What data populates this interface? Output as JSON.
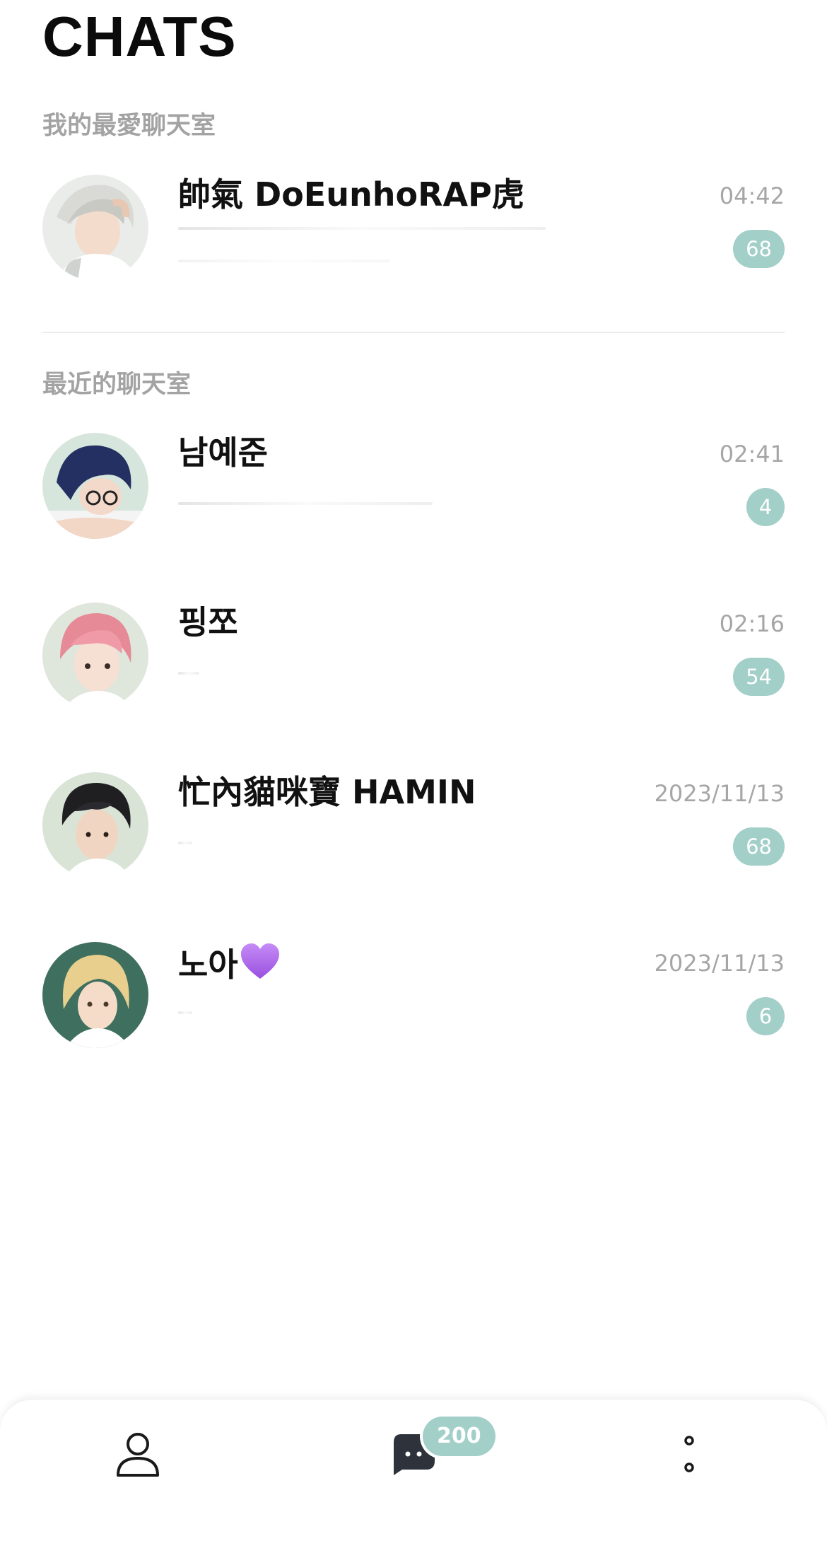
{
  "header": {
    "title": "CHATS"
  },
  "sections": {
    "favorites_label": "我的最愛聊天室",
    "recent_label": "最近的聊天室"
  },
  "favorites": [
    {
      "name": "帥氣 DoEunhoRAP虎",
      "time": "04:42",
      "unread": "68",
      "avatar": "avatar-silver-hair"
    }
  ],
  "recent": [
    {
      "name": "남예준",
      "time": "02:41",
      "unread": "4",
      "avatar": "avatar-navy-hair-glasses"
    },
    {
      "name": "핑쪼",
      "time": "02:16",
      "unread": "54",
      "avatar": "avatar-pink-hair"
    },
    {
      "name": "忙內貓咪寶 HAMIN",
      "time": "2023/11/13",
      "unread": "68",
      "avatar": "avatar-black-hair"
    },
    {
      "name": "노아",
      "name_emoji": "purple-heart-icon",
      "time": "2023/11/13",
      "unread": "6",
      "avatar": "avatar-blonde-hair"
    }
  ],
  "bottom_nav": {
    "items": [
      {
        "icon": "person-icon"
      },
      {
        "icon": "chat-bubble-icon",
        "badge": "200"
      },
      {
        "icon": "more-dots-icon"
      }
    ]
  },
  "colors": {
    "badge": "#a3cfc9",
    "muted_text": "#a6a6a6",
    "divider": "#ececec"
  }
}
